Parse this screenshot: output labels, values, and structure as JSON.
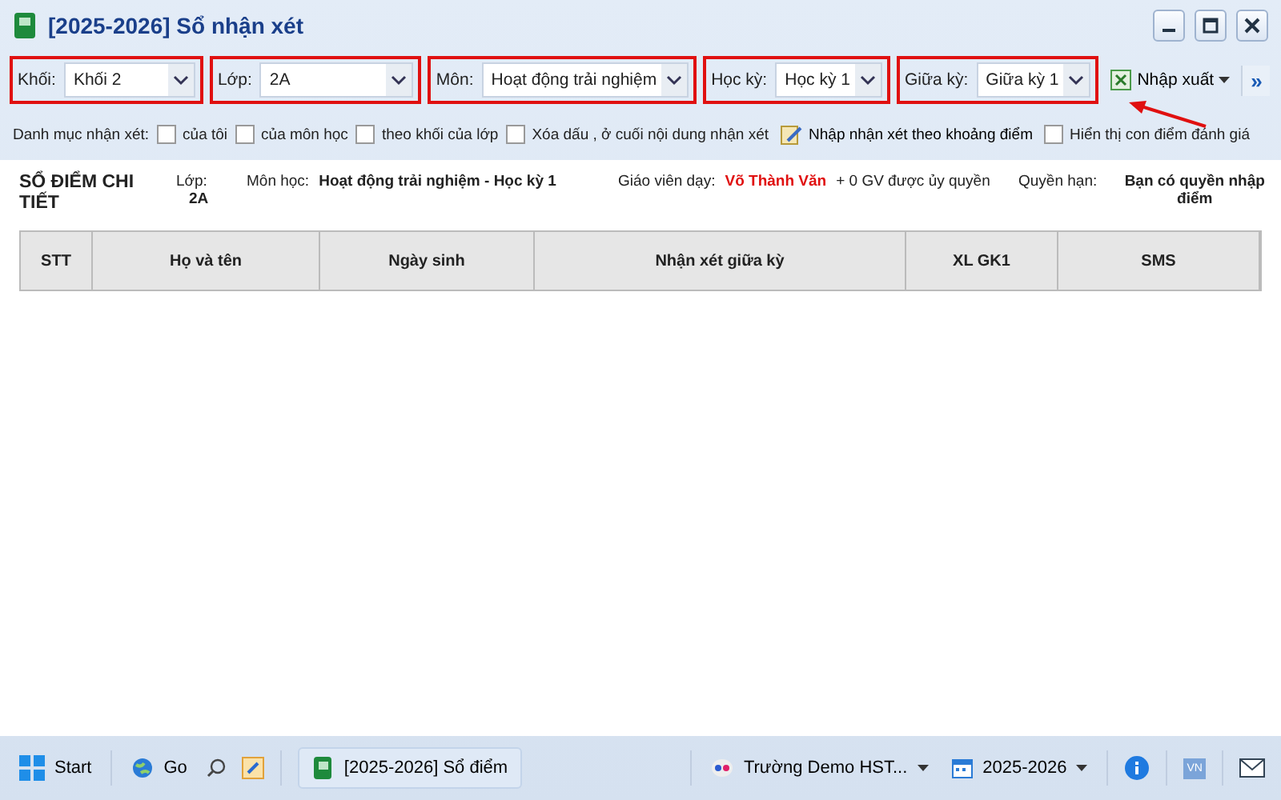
{
  "window": {
    "title": "[2025-2026] Sổ nhận xét"
  },
  "filters": [
    {
      "label": "Khối:",
      "value": "Khối 2",
      "highlighted": true
    },
    {
      "label": "Lớp:",
      "value": "2A",
      "highlighted": true
    },
    {
      "label": "Môn:",
      "value": "Hoạt động trải nghiệm",
      "highlighted": true
    },
    {
      "label": "Học kỳ:",
      "value": "Học kỳ 1",
      "highlighted": true
    },
    {
      "label": "Giữa kỳ:",
      "value": "Giữa kỳ 1",
      "highlighted": true
    }
  ],
  "import_export": {
    "label": "Nhập xuất"
  },
  "more": {
    "label": "»"
  },
  "options": {
    "label": "Danh mục nhận xét:",
    "items": [
      {
        "kind": "checkbox",
        "label": "của tôi",
        "checked": false
      },
      {
        "kind": "checkbox",
        "label": "của môn học",
        "checked": false
      },
      {
        "kind": "checkbox",
        "label": "theo khối của lớp",
        "checked": false
      },
      {
        "kind": "checkbox",
        "label": "Xóa dấu , ở cuối nội dung nhận xét",
        "checked": false
      },
      {
        "kind": "action",
        "label": "Nhập nhận xét theo khoảng điểm"
      },
      {
        "kind": "checkbox",
        "label": "Hiển thị con điểm đánh giá",
        "checked": false
      }
    ]
  },
  "summary": {
    "title": "SỔ ĐIỂM CHI TIẾT",
    "class_label": "Lớp:",
    "class_value": "2A",
    "subject_label": "Môn học:",
    "subject_value": "Hoạt động trải nghiệm - Học kỳ 1",
    "teacher_label": "Giáo viên dạy:",
    "teacher_value": "Võ Thành Văn",
    "teacher_extra": "+ 0 GV được ủy quyền",
    "rights_label": "Quyền hạn:",
    "rights_value": "Bạn có quyền nhập điểm"
  },
  "table": {
    "columns": [
      "STT",
      "Họ và tên",
      "Ngày sinh",
      "Nhận xét giữa kỳ",
      "XL GK1",
      "SMS"
    ]
  },
  "taskbar": {
    "start": "Start",
    "go": "Go",
    "task": "[2025-2026] Sổ điểm",
    "school": "Trường Demo HST...",
    "year": "2025-2026",
    "lang": "VN"
  }
}
